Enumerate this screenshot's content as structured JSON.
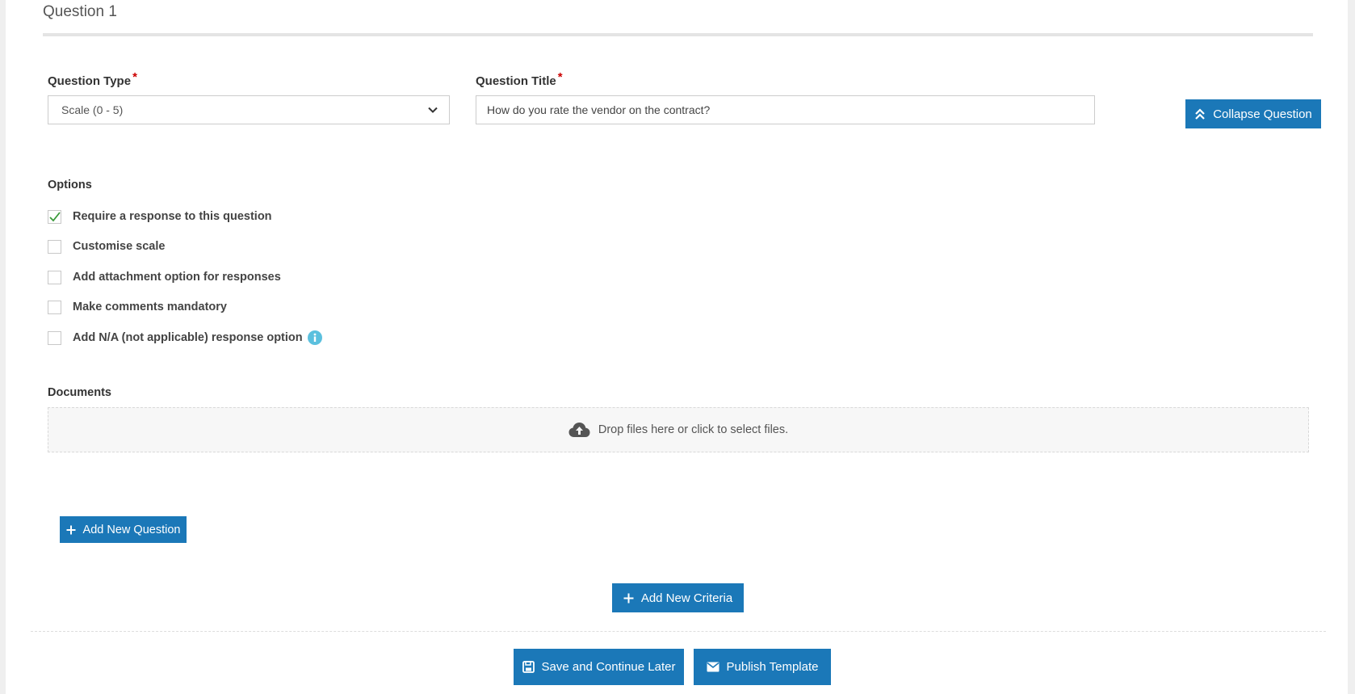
{
  "question": {
    "heading": "Question 1",
    "type_label": "Question Type",
    "type_value": "Scale (0 - 5)",
    "title_label": "Question Title",
    "title_value": "How do you rate the vendor on the contract?",
    "required_mark": "*",
    "collapse_label": "Collapse Question"
  },
  "options": {
    "label": "Options",
    "items": [
      {
        "label": "Require a response to this question",
        "checked": true
      },
      {
        "label": "Customise scale",
        "checked": false
      },
      {
        "label": "Add attachment option for responses",
        "checked": false
      },
      {
        "label": "Make comments mandatory",
        "checked": false
      },
      {
        "label": "Add N/A (not applicable) response option",
        "checked": false
      }
    ]
  },
  "documents": {
    "label": "Documents",
    "drop_text": "Drop files here or click to select files."
  },
  "actions": {
    "add_question": "Add New Question",
    "add_criteria": "Add New Criteria",
    "save_later": "Save and Continue Later",
    "publish": "Publish Template"
  },
  "colors": {
    "primary": "#1b78b8",
    "required": "#cc0000",
    "check": "#3a9a3a",
    "info": "#5bc0de"
  },
  "icons": {
    "select_toggle": "chevron-down-icon",
    "collapse": "double-chevron-up-icon",
    "info": "info-icon",
    "upload": "cloud-upload-icon",
    "add": "plus-icon",
    "save": "save-icon",
    "publish": "envelope-icon"
  }
}
